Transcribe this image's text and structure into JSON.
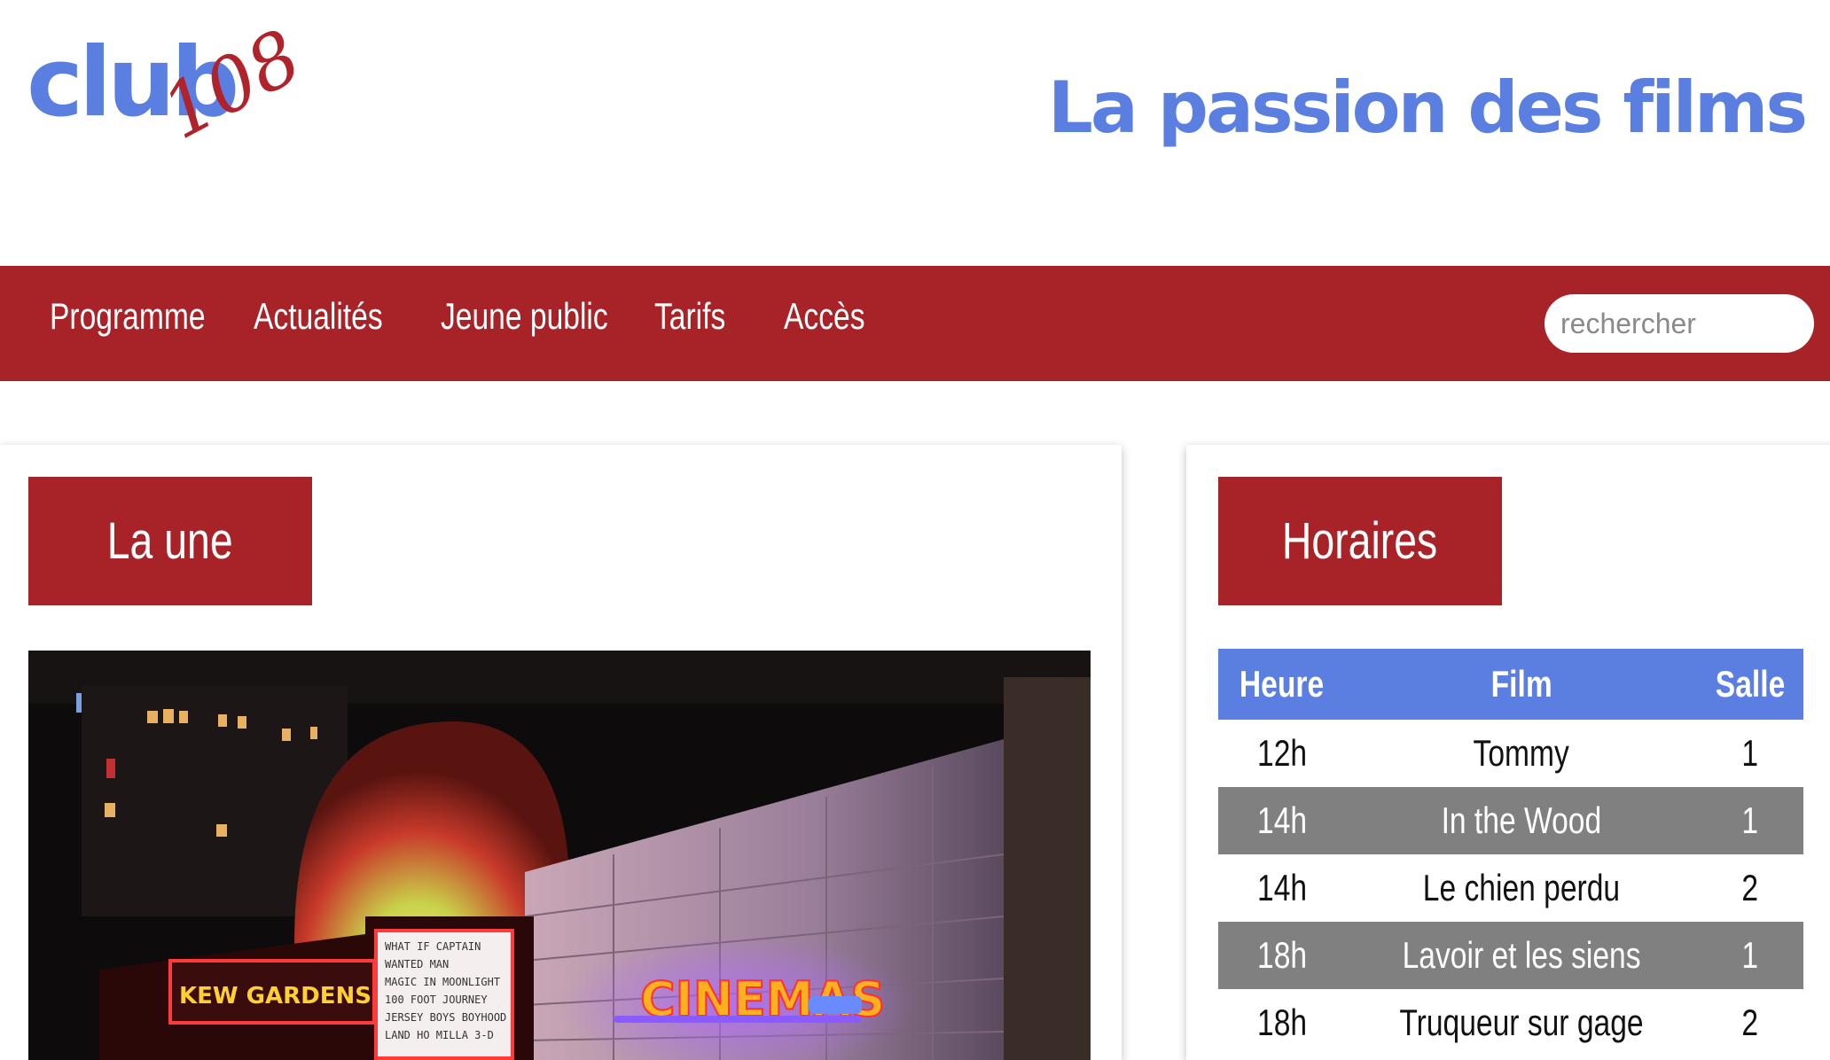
{
  "header": {
    "logo_text": "club",
    "logo_number": "108",
    "tagline": "La passion des films"
  },
  "nav": {
    "items": [
      "Programme",
      "Actualités",
      "Jeune public",
      "Tarifs",
      "Accès"
    ],
    "search_placeholder": "rechercher"
  },
  "main": {
    "title": "La une",
    "image_text": {
      "marquee_left": "KEW GARDENS CINEMAS",
      "marquee_right": "CINEMAS",
      "board_lines": [
        "WHAT IF   CAPTAIN",
        "WANTED MAN",
        "MAGIC IN MOONLIGHT",
        "100 FOOT JOURNEY",
        "JERSEY BOYS BOYHOOD",
        "LAND HO   MILLA 3-D"
      ]
    }
  },
  "sidebar": {
    "title": "Horaires",
    "columns": [
      "Heure",
      "Film",
      "Salle"
    ],
    "rows": [
      {
        "time": "12h",
        "film": "Tommy",
        "room": "1"
      },
      {
        "time": "14h",
        "film": "In the Wood",
        "room": "1"
      },
      {
        "time": "14h",
        "film": "Le chien perdu",
        "room": "2"
      },
      {
        "time": "18h",
        "film": "Lavoir et les siens",
        "room": "1"
      },
      {
        "time": "18h",
        "film": "Truqueur sur gage",
        "room": "2"
      }
    ]
  },
  "colors": {
    "brand_red": "#a82328",
    "brand_blue": "#5b7fe0",
    "row_gray": "#808080"
  }
}
